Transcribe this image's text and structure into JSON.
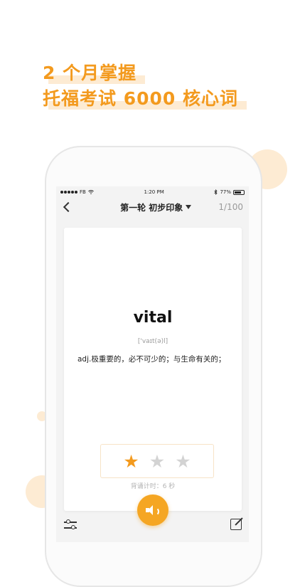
{
  "headline": {
    "line1": "2 个月掌握",
    "line2": "托福考试 6000 核心词"
  },
  "status_bar": {
    "carrier": "FB",
    "time": "1:20 PM",
    "battery": "77%"
  },
  "nav": {
    "title": "第一轮 初步印象",
    "progress": "1/100"
  },
  "card": {
    "word": "vital",
    "phonetic": "['vaɪt(ə)l]",
    "definition": "adj.极重要的，必不可少的；与生命有关的；"
  },
  "rating": {
    "stars_total": 3,
    "stars_filled": 1
  },
  "timer_text": "背诵计时：6 秒",
  "colors": {
    "accent": "#F39A1E",
    "accent_light": "#FDEBD3",
    "star_off": "#D3D3D3"
  },
  "icons": [
    "back-icon",
    "caret-down-icon",
    "star-icon",
    "filter-icon",
    "edit-icon",
    "speaker-icon",
    "wifi-icon",
    "bluetooth-icon",
    "battery-icon"
  ]
}
